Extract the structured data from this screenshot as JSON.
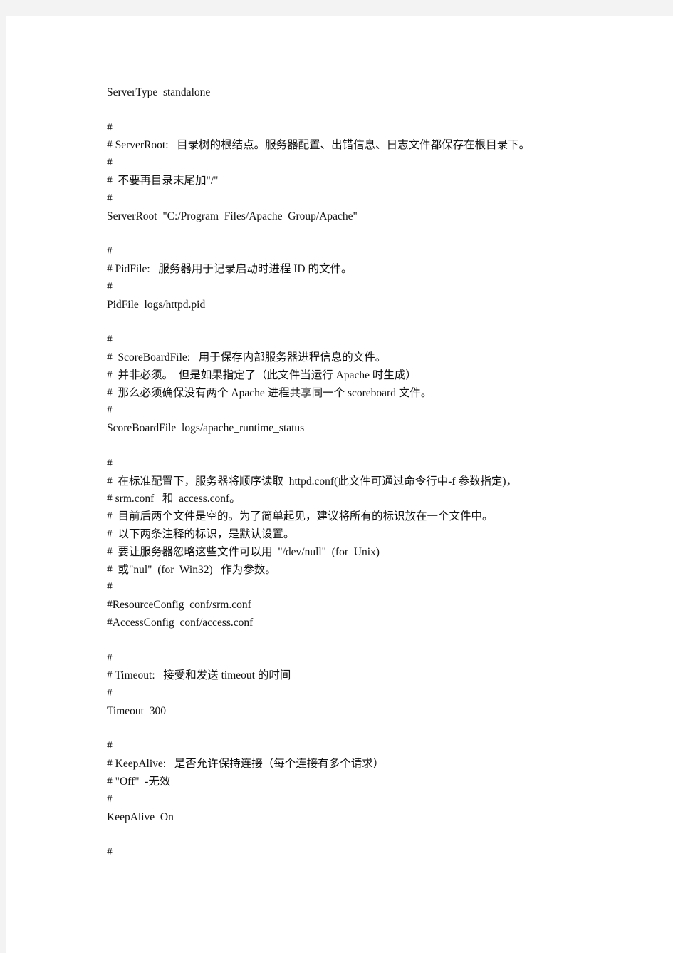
{
  "document": {
    "lines": [
      "ServerType  standalone",
      "",
      "#",
      "# ServerRoot:   目录树的根结点。服务器配置、出错信息、日志文件都保存在根目录下。",
      "#",
      "#  不要再目录末尾加\"/\"",
      "#",
      "ServerRoot  \"C:/Program  Files/Apache  Group/Apache\"",
      "",
      "#",
      "# PidFile:   服务器用于记录启动时进程 ID 的文件。",
      "#",
      "PidFile  logs/httpd.pid",
      "",
      "#",
      "#  ScoreBoardFile:   用于保存内部服务器进程信息的文件。",
      "#  并非必须。  但是如果指定了（此文件当运行 Apache 时生成）",
      "#  那么必须确保没有两个 Apache 进程共享同一个 scoreboard 文件。",
      "#",
      "ScoreBoardFile  logs/apache_runtime_status",
      "",
      "#",
      "#  在标准配置下，服务器将顺序读取  httpd.conf(此文件可通过命令行中-f 参数指定)，",
      "# srm.conf   和  access.conf。",
      "#  目前后两个文件是空的。为了简单起见，建议将所有的标识放在一个文件中。",
      "#  以下两条注释的标识，是默认设置。",
      "#  要让服务器忽略这些文件可以用  \"/dev/null\"  (for  Unix)",
      "#  或\"nul\"  (for  Win32)   作为参数。",
      "#",
      "#ResourceConfig  conf/srm.conf",
      "#AccessConfig  conf/access.conf",
      "",
      "#",
      "# Timeout:   接受和发送 timeout 的时间",
      "#",
      "Timeout  300",
      "",
      "#",
      "# KeepAlive:   是否允许保持连接（每个连接有多个请求）",
      "# \"Off\"  -无效",
      "#",
      "KeepAlive  On",
      "",
      "#"
    ]
  }
}
